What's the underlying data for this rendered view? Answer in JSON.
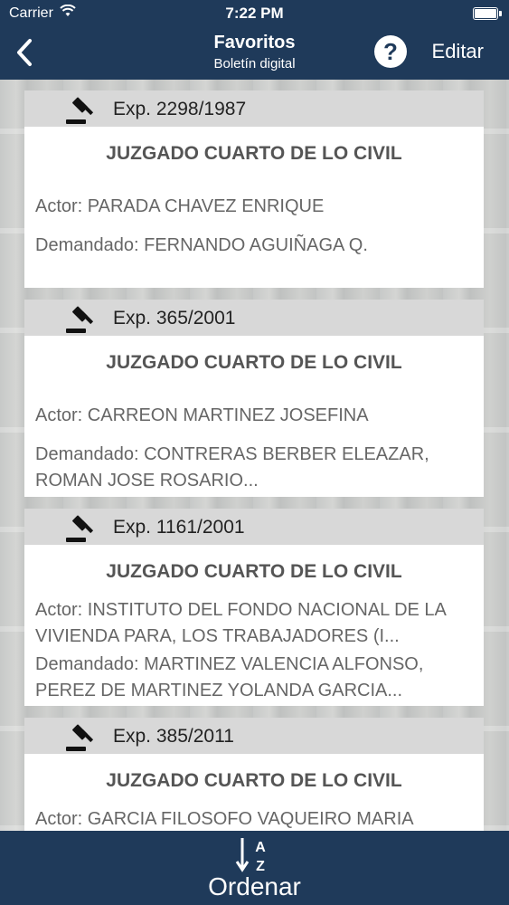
{
  "status_bar": {
    "carrier": "Carrier",
    "time": "7:22 PM"
  },
  "nav": {
    "title": "Favoritos",
    "subtitle": "Boletín digital",
    "help_label": "?",
    "edit_label": "Editar"
  },
  "cards": [
    {
      "exp": "Exp. 2298/1987",
      "court": "JUZGADO CUARTO DE LO CIVIL",
      "actor": "Actor: PARADA CHAVEZ ENRIQUE",
      "demandado": "Demandado: FERNANDO AGUIÑAGA Q."
    },
    {
      "exp": "Exp. 365/2001",
      "court": "JUZGADO CUARTO DE LO CIVIL",
      "actor": "Actor: CARREON MARTINEZ JOSEFINA",
      "demandado": "Demandado: CONTRERAS BERBER ELEAZAR, ROMAN JOSE ROSARIO..."
    },
    {
      "exp": "Exp. 1161/2001",
      "court": "JUZGADO CUARTO DE LO CIVIL",
      "actor": "Actor: INSTITUTO DEL FONDO NACIONAL DE LA VIVIENDA PARA, LOS TRABAJADORES (I...",
      "demandado": "Demandado: MARTINEZ VALENCIA ALFONSO, PEREZ DE MARTINEZ YOLANDA GARCIA..."
    },
    {
      "exp": "Exp. 385/2011",
      "court": "JUZGADO CUARTO DE LO CIVIL",
      "actor": "Actor: GARCIA FILOSOFO VAQUEIRO MARIA",
      "demandado": ""
    }
  ],
  "bottom": {
    "sort_label": "Ordenar",
    "sort_letters": {
      "top": "A",
      "bottom": "Z"
    }
  },
  "colors": {
    "nav_bg": "#1f3a5a",
    "card_header_bg": "#d8d8d8"
  },
  "icons": {
    "back": "chevron-left-icon",
    "help": "question-circle-icon",
    "gavel": "gavel-icon",
    "sort": "sort-alpha-icon"
  }
}
